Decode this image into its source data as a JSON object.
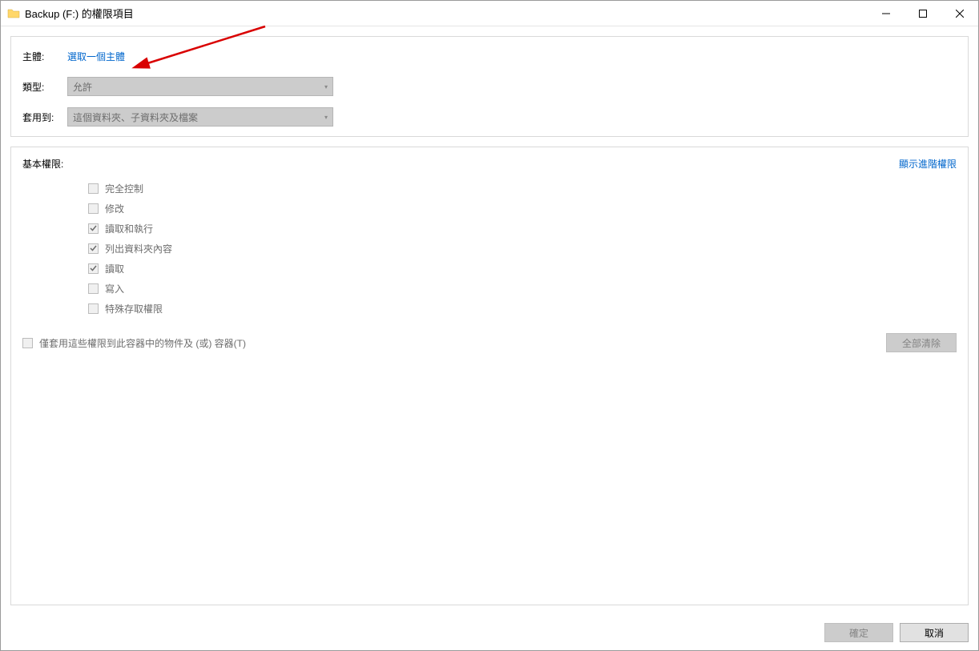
{
  "titlebar": {
    "icon": "folder-icon",
    "title": "Backup (F:) 的權限項目"
  },
  "top_panel": {
    "principal_label": "主體:",
    "principal_link": "選取一個主體",
    "type_label": "類型:",
    "type_value": "允許",
    "applies_label": "套用到:",
    "applies_value": "這個資料夾、子資料夾及檔案"
  },
  "permissions": {
    "header": "基本權限:",
    "show_advanced": "顯示進階權限",
    "items": [
      {
        "label": "完全控制",
        "checked": false
      },
      {
        "label": "修改",
        "checked": false
      },
      {
        "label": "讀取和執行",
        "checked": true
      },
      {
        "label": "列出資料夾內容",
        "checked": true
      },
      {
        "label": "讀取",
        "checked": true
      },
      {
        "label": "寫入",
        "checked": false
      },
      {
        "label": "特殊存取權限",
        "checked": false
      }
    ],
    "apply_only_label": "僅套用這些權限到此容器中的物件及 (或) 容器(T)",
    "clear_all": "全部清除"
  },
  "footer": {
    "ok": "確定",
    "cancel": "取消"
  }
}
